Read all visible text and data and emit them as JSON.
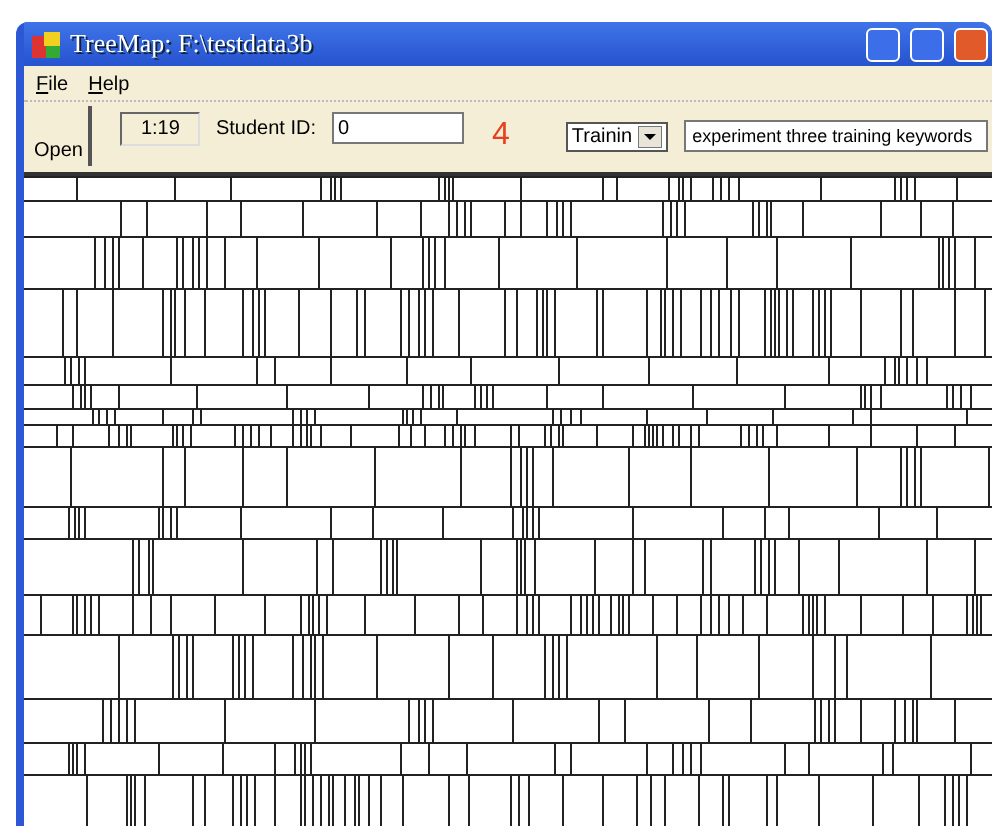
{
  "window": {
    "title": "TreeMap: F:\\testdata3b"
  },
  "menu": [
    {
      "label": "File"
    },
    {
      "label": "Help"
    }
  ],
  "toolbar": {
    "open_button": "Open",
    "time": "1:19",
    "student_label": "Student ID:",
    "student_id": "0",
    "count": "4",
    "mode": "Trainin",
    "keywords": "experiment three training keywords"
  }
}
